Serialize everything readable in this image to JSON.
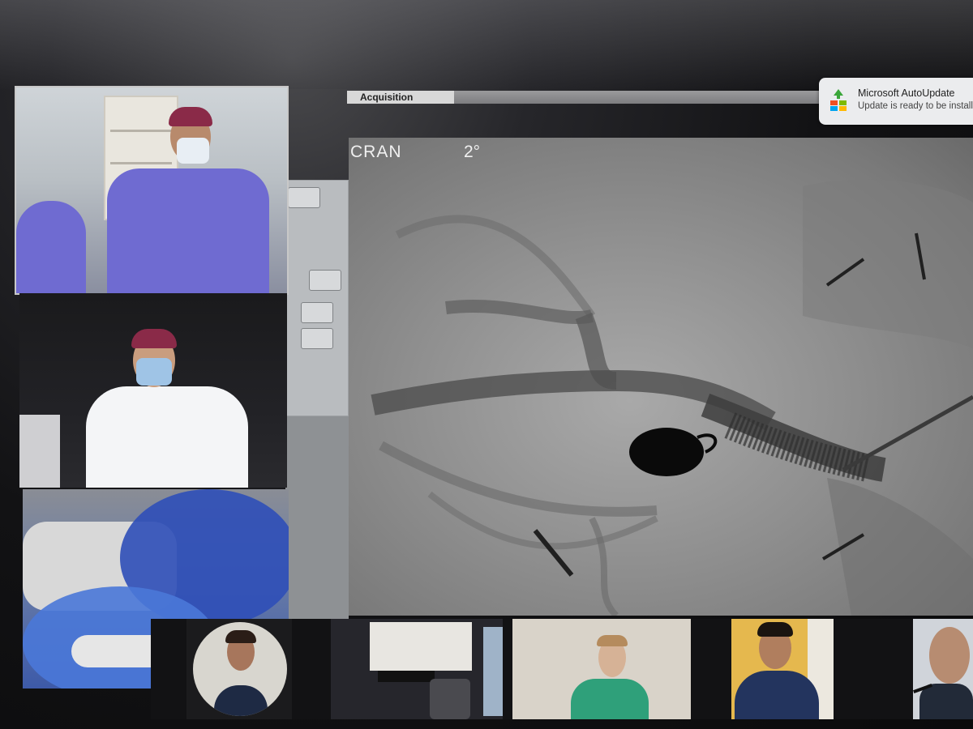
{
  "viewer": {
    "acquisition_label": "Acquisition",
    "projection_label": "CRAN",
    "angle_label": "2°"
  },
  "notification": {
    "app_name": "Microsoft AutoUpdate",
    "message": "Update is ready to be installe",
    "icon": "microsoft-autoupdate-icon"
  },
  "participants": {
    "gallery": [
      {
        "id": "surgeon-standing",
        "attire": "blue scrubs, maroon cap, mask"
      },
      {
        "id": "physician-white-coat",
        "attire": "white coat, maroon cap, mask"
      },
      {
        "id": "procedure-room-camera",
        "attire": "blue drapes"
      }
    ],
    "strip": [
      {
        "id": "participant-man-suit"
      },
      {
        "id": "participant-empty-room"
      },
      {
        "id": "participant-green-scrubs"
      },
      {
        "id": "participant-smiling-jacket"
      },
      {
        "id": "participant-speaker-mic"
      }
    ]
  },
  "colors": {
    "scrubs": "#6f6bd1",
    "cap": "#8a2a48",
    "fluoro_bg": "#8f8f8f",
    "coil": "#0a0a0a",
    "notification_bg": "#ebecee"
  }
}
